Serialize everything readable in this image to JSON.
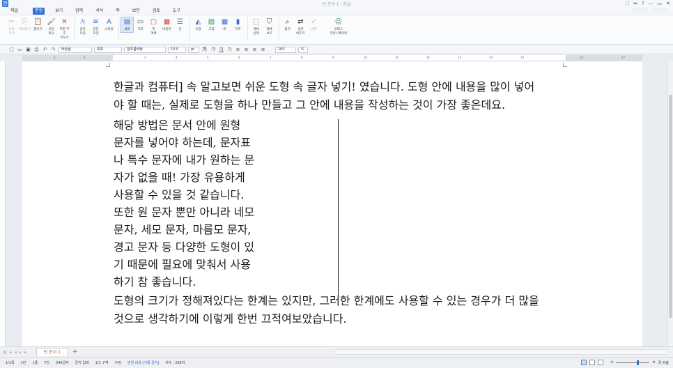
{
  "window": {
    "title": "빈 문서 1 - 한글",
    "controls": [
      "⛶",
      "⇔",
      "?",
      "—",
      "▭",
      "✕"
    ]
  },
  "menu": {
    "items": [
      "파일",
      "편집",
      "보기",
      "입력",
      "서식",
      "쪽",
      "보안",
      "검토",
      "도구"
    ]
  },
  "ribbon": {
    "buttons": [
      {
        "label": "오려\n두기",
        "icon": "✂",
        "dim": true
      },
      {
        "label": "복사하기",
        "icon": "⎘",
        "dim": true
      },
      {
        "label": "붙이기",
        "icon": "📋",
        "dim": false
      },
      {
        "label": "모양\n복사",
        "icon": "🖌",
        "dim": false
      },
      {
        "label": "조판 부호\n지우기",
        "icon": "✕",
        "dim": false
      },
      {
        "label": "글자\n모양",
        "icon": "가",
        "dim": false
      },
      {
        "label": "문단\n모양",
        "icon": "≡",
        "dim": false
      },
      {
        "label": "스타일",
        "icon": "A",
        "dim": false
      },
      {
        "label": "세로",
        "icon": "▤",
        "dim": false,
        "selected": true
      },
      {
        "label": "가로",
        "icon": "▭",
        "dim": false
      },
      {
        "label": "쪽\n여백",
        "icon": "▢",
        "dim": false
      },
      {
        "label": "바탕쪽",
        "icon": "▦",
        "dim": false
      },
      {
        "label": "단",
        "icon": "☰",
        "dim": false
      },
      {
        "label": "도형",
        "icon": "◭",
        "dim": false
      },
      {
        "label": "그림",
        "icon": "▨",
        "dim": false
      },
      {
        "label": "표",
        "icon": "▦",
        "dim": false
      },
      {
        "label": "차트",
        "icon": "▮",
        "dim": false
      },
      {
        "label": "개체\n선택",
        "icon": "⬚",
        "dim": false
      },
      {
        "label": "개체\n보호",
        "icon": "⛉",
        "dim": false
      },
      {
        "label": "찾기",
        "icon": "⌕",
        "dim": false
      },
      {
        "label": "글자\n바꾸기",
        "icon": "⇄",
        "dim": false
      },
      {
        "label": "검정",
        "icon": "✓",
        "dim": true
      },
      {
        "label": "오피스\n커뮤니케이터",
        "icon": "☺",
        "dim": false
      }
    ]
  },
  "format_bar": {
    "style": "바탕글",
    "font_category": "대표",
    "font": "함초롬바탕",
    "font_size": "10.0",
    "unit": "pt",
    "zoom": "160",
    "zoom_unit": "%"
  },
  "ruler": {
    "numbers": [
      "1",
      "2",
      "3",
      "4",
      "5",
      "6",
      "7",
      "8",
      "9",
      "10",
      "11",
      "12",
      "13",
      "14",
      "15",
      "16",
      "17"
    ]
  },
  "document": {
    "para1": [
      "한글과 컴퓨터] 속 알고보면 쉬운 도형 속 글자 넣기! 였습니다. 도형 안에 내용을 많이 넣어",
      "야 할 때는, 실제로 도형을 하나 만들고 그 안에 내용을 작성하는 것이 가장 좋은데요."
    ],
    "column": [
      "해당  방법은  문서  안에  원형",
      "문자를  넣어야  하는데,  문자표",
      "나 특수 문자에 내가 원하는 문",
      "자가  없을  때!  가장  유용하게",
      "사용할  수  있을  것  같습니다.",
      "또한 원 문자 뿐만 아니라 네모",
      "문자,  세모  문자,  마름모  문자,",
      "경고  문자  등  다양한  도형이  있",
      "기  때문에  필요에  맞춰서  사용",
      "하기 참 좋습니다."
    ],
    "para2": [
      "도형의 크기가 정해져있다는 한계는 있지만, 그러한 한계에도 사용할 수 있는 경우가 더 많을",
      "것으로 생각하기에 이렇게 한번 끄적여보았습니다."
    ]
  },
  "tabs": {
    "doc_tab": "빈 문서 1",
    "add": "+"
  },
  "status": {
    "page": "1/1쪽",
    "section": "1단",
    "line": "1줄",
    "column": "7칸",
    "chars": "346글자",
    "input": "문자 입력",
    "area": "1/1 구역",
    "mode": "수정",
    "track": "변경 내용 [기록 중지]",
    "count": "자수 : 282자",
    "zoom_label": "쪽 맞춤"
  }
}
